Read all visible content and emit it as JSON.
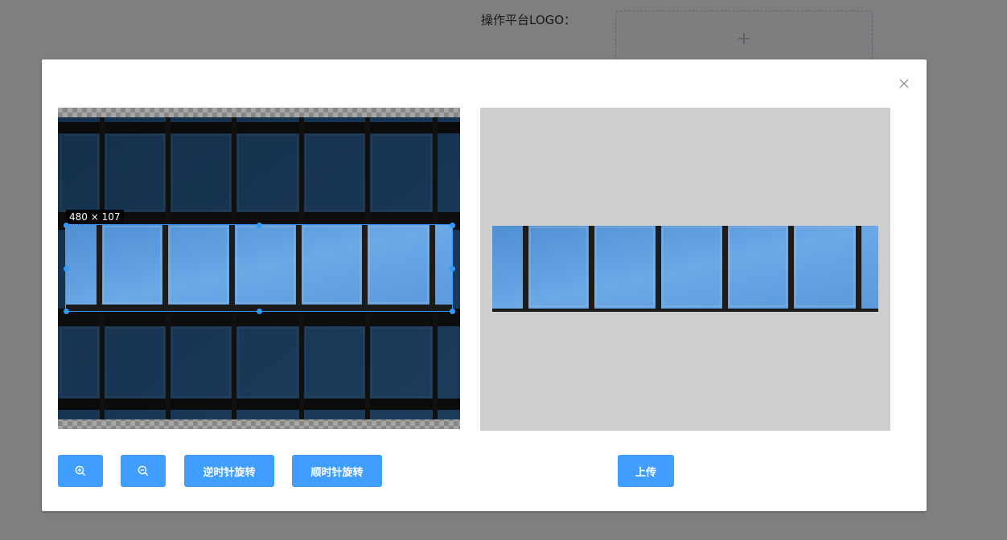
{
  "background": {
    "logo_label": "操作平台LOGO：",
    "upload_plus": "+"
  },
  "dialog": {
    "close_icon": "close-icon",
    "cropper": {
      "crop_size": "480 × 107"
    },
    "buttons": {
      "zoom_in_icon": "zoom-in-icon",
      "zoom_out_icon": "zoom-out-icon",
      "rotate_left": "逆时针旋转",
      "rotate_right": "顺时针旋转",
      "upload": "上传"
    }
  },
  "colors": {
    "primary": "#409eff",
    "crop_outline": "#3399ff",
    "preview_bg": "#cecece",
    "overlay": "rgba(0,0,0,0.5)"
  }
}
